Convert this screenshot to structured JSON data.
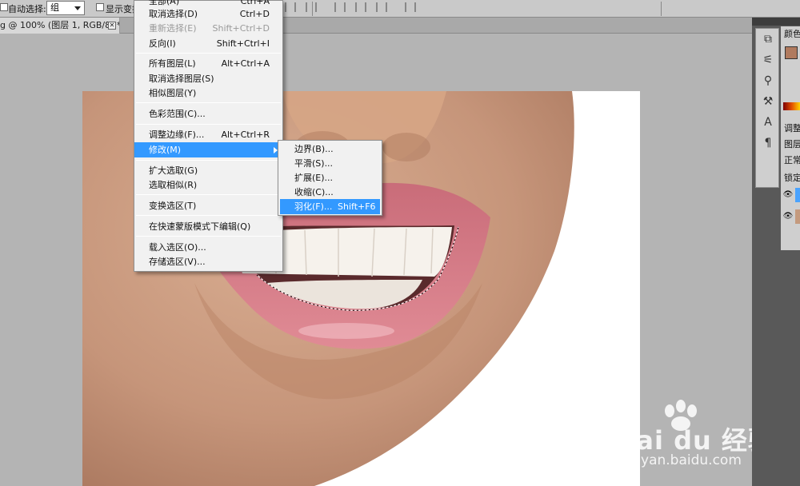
{
  "options_bar": {
    "auto_select_label": "自动选择:",
    "auto_select_value": "组",
    "show_transform_label": "显示变换"
  },
  "document_tab": {
    "title": "g @ 100% (图层 1, RGB/8) *",
    "close_glyph": "✕"
  },
  "select_menu": {
    "items": [
      {
        "label": "全部(A)",
        "shortcut": "Ctrl+A"
      },
      {
        "label": "取消选择(D)",
        "shortcut": "Ctrl+D"
      },
      {
        "label": "重新选择(E)",
        "shortcut": "Shift+Ctrl+D",
        "disabled": true
      },
      {
        "label": "反向(I)",
        "shortcut": "Shift+Ctrl+I"
      },
      {
        "label": "所有图层(L)",
        "shortcut": "Alt+Ctrl+A"
      },
      {
        "label": "取消选择图层(S)",
        "shortcut": ""
      },
      {
        "label": "相似图层(Y)",
        "shortcut": ""
      },
      {
        "label": "色彩范围(C)...",
        "shortcut": ""
      },
      {
        "label": "调整边缘(F)...",
        "shortcut": "Alt+Ctrl+R"
      },
      {
        "label": "修改(M)",
        "shortcut": "",
        "highlighted": true,
        "has_submenu": true
      },
      {
        "label": "扩大选取(G)",
        "shortcut": ""
      },
      {
        "label": "选取相似(R)",
        "shortcut": ""
      },
      {
        "label": "变换选区(T)",
        "shortcut": ""
      },
      {
        "label": "在快速蒙版模式下编辑(Q)",
        "shortcut": ""
      },
      {
        "label": "载入选区(O)...",
        "shortcut": ""
      },
      {
        "label": "存储选区(V)...",
        "shortcut": ""
      }
    ]
  },
  "modify_submenu": {
    "items": [
      {
        "label": "边界(B)...",
        "shortcut": ""
      },
      {
        "label": "平滑(S)...",
        "shortcut": ""
      },
      {
        "label": "扩展(E)...",
        "shortcut": ""
      },
      {
        "label": "收缩(C)...",
        "shortcut": ""
      },
      {
        "label": "羽化(F)...",
        "shortcut": "Shift+F6",
        "highlighted": true
      }
    ]
  },
  "right_panel": {
    "color_tab": "颜色",
    "adjust_tab": "调整",
    "layers_tab": "图层",
    "blend_mode": "正常",
    "lock_label": "锁定",
    "foreground_color": "#b07a5e"
  },
  "tool_icons": [
    "layer-comp-icon",
    "brush-preset-icon",
    "clone-source-icon",
    "tool-preset-icon",
    "character-icon",
    "paragraph-icon"
  ],
  "watermark": {
    "brand": "Bai du 经验",
    "url": "jingyan.baidu.com"
  },
  "colors": {
    "menu_highlight": "#3399ff",
    "menu_bg": "#f1f1f1"
  }
}
